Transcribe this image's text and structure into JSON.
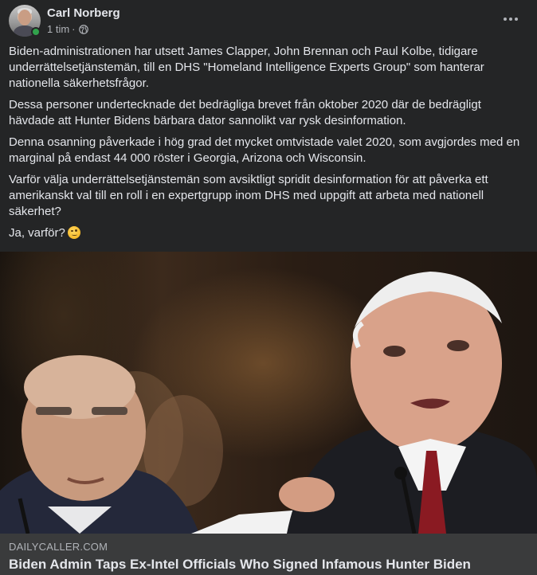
{
  "post": {
    "author": "Carl Norberg",
    "time": "1 tim",
    "separator": "·",
    "icons": {
      "privacy": "globe-icon",
      "menu": "more-horizontal-icon",
      "emoji": "winking-face-emoji"
    },
    "paragraphs": [
      "Biden-administrationen har utsett James Clapper, John Brennan och Paul Kolbe, tidigare underrättelsetjänstemän, till en DHS \"Homeland Intelligence Experts Group\" som hanterar nationella säkerhetsfrågor.",
      "Dessa personer undertecknade det bedrägliga brevet från oktober 2020 där de bedrägligt hävdade att Hunter Bidens bärbara dator sannolikt var rysk desinformation.",
      "Denna osanning påverkade i hög grad det mycket omtvistade valet 2020, som avgjordes med en marginal på endast 44 000 röster i Georgia, Arizona och Wisconsin.",
      "Varför välja underrättelsetjänstemän som avsiktligt spridit desinformation för att påverka ett amerikanskt val till en roll i en expertgrupp inom DHS med uppgift att arbeta med nationell säkerhet?"
    ],
    "closing": "Ja, varför?"
  },
  "link": {
    "domain": "DAILYCALLER.COM",
    "title": "Biden Admin Taps Ex-Intel Officials Who Signed Infamous Hunter Biden"
  },
  "colors": {
    "background": "#242526",
    "text": "#e4e6eb",
    "secondary_text": "#b0b3b8",
    "link_footer": "#3a3b3c",
    "online": "#31a24c"
  }
}
